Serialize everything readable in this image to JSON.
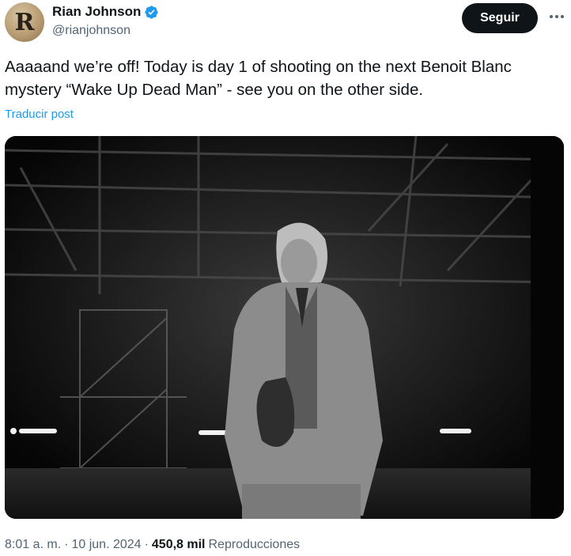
{
  "author": {
    "avatar_letter": "R",
    "display_name": "Rian Johnson",
    "handle": "@rianjohnson",
    "verified": true
  },
  "actions": {
    "follow_label": "Seguir",
    "more_icon": "more-horizontal-icon"
  },
  "tweet": {
    "text_line1": "Aaaaand we’re off! Today is day 1 of shooting on the next Benoit Blanc",
    "text_line2": "mystery “Wake Up Dead Man” - see you on the other side.",
    "translate_label": "Traducir post"
  },
  "media": {
    "kind": "black-and-white photo of a man in a three-piece suit holding a hat on an empty soundstage"
  },
  "meta": {
    "time": "8:01 a. m.",
    "separator1": "·",
    "date": "10 jun. 2024",
    "separator2": "·",
    "views_count": "450,8 mil",
    "views_label": "Reproducciones"
  },
  "colors": {
    "text": "#0f1419",
    "secondary": "#536471",
    "link": "#1d9bf0",
    "verified": "#1d9bf0",
    "button_bg": "#0f1419"
  }
}
